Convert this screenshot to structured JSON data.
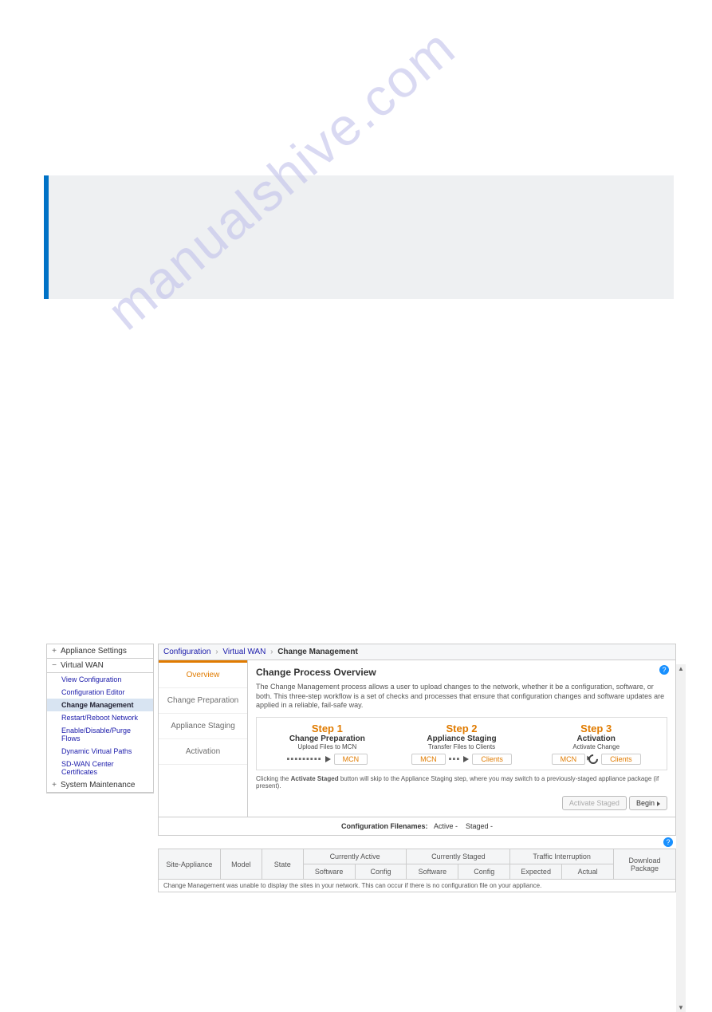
{
  "watermark": "manualshive.com",
  "sidebar": {
    "sections": [
      {
        "icon": "+",
        "label": "Appliance Settings"
      },
      {
        "icon": "−",
        "label": "Virtual WAN",
        "items": [
          {
            "label": "View Configuration",
            "link": true
          },
          {
            "label": "Configuration Editor",
            "link": true
          },
          {
            "label": "Change Management",
            "active": true
          },
          {
            "label": "Restart/Reboot Network",
            "link": true
          },
          {
            "label": "Enable/Disable/Purge Flows",
            "link": true
          },
          {
            "label": "Dynamic Virtual Paths",
            "link": true
          },
          {
            "label": "SD-WAN Center Certificates",
            "link": true
          }
        ]
      },
      {
        "icon": "+",
        "label": "System Maintenance"
      }
    ]
  },
  "breadcrumb": {
    "a": "Configuration",
    "b": "Virtual WAN",
    "c": "Change Management"
  },
  "stepTabs": [
    {
      "label": "Overview",
      "sel": true
    },
    {
      "label": "Change Preparation"
    },
    {
      "label": "Appliance Staging"
    },
    {
      "label": "Activation"
    }
  ],
  "panel": {
    "title": "Change Process Overview",
    "desc": "The Change Management process allows a user to upload changes to the network, whether it be a configuration, software, or both. This three-step workflow is a set of checks and processes that ensure that configuration changes and software updates are applied in a reliable, fail-safe way.",
    "steps": [
      {
        "st": "Step 1",
        "sn": "Change Preparation",
        "sd": "Upload Files to MCN",
        "chipA": "MCN"
      },
      {
        "st": "Step 2",
        "sn": "Appliance Staging",
        "sd": "Transfer Files to Clients",
        "chipA": "MCN",
        "chipB": "Clients"
      },
      {
        "st": "Step 3",
        "sn": "Activation",
        "sd": "Activate Change",
        "chipA": "MCN",
        "chipB": "Clients"
      }
    ],
    "note_pre": "Clicking the ",
    "note_b": "Activate Staged",
    "note_post": " button will skip to the Appliance Staging step, where you may switch to a previously-staged appliance package (if present).",
    "btnActivate": "Activate Staged",
    "btnBegin": "Begin"
  },
  "cfg": {
    "label": "Configuration Filenames:",
    "active": "Active -",
    "staged": "Staged -"
  },
  "table": {
    "h": {
      "site": "Site-Appliance",
      "model": "Model",
      "state": "State",
      "curA": "Currently Active",
      "curS": "Currently Staged",
      "ti": "Traffic Interruption",
      "dl": "Download Package",
      "sw": "Software",
      "cf": "Config",
      "ex": "Expected",
      "ac": "Actual"
    },
    "empty": "Change Management was unable to display the sites in your network. This can occur if there is no configuration file on your appliance."
  }
}
